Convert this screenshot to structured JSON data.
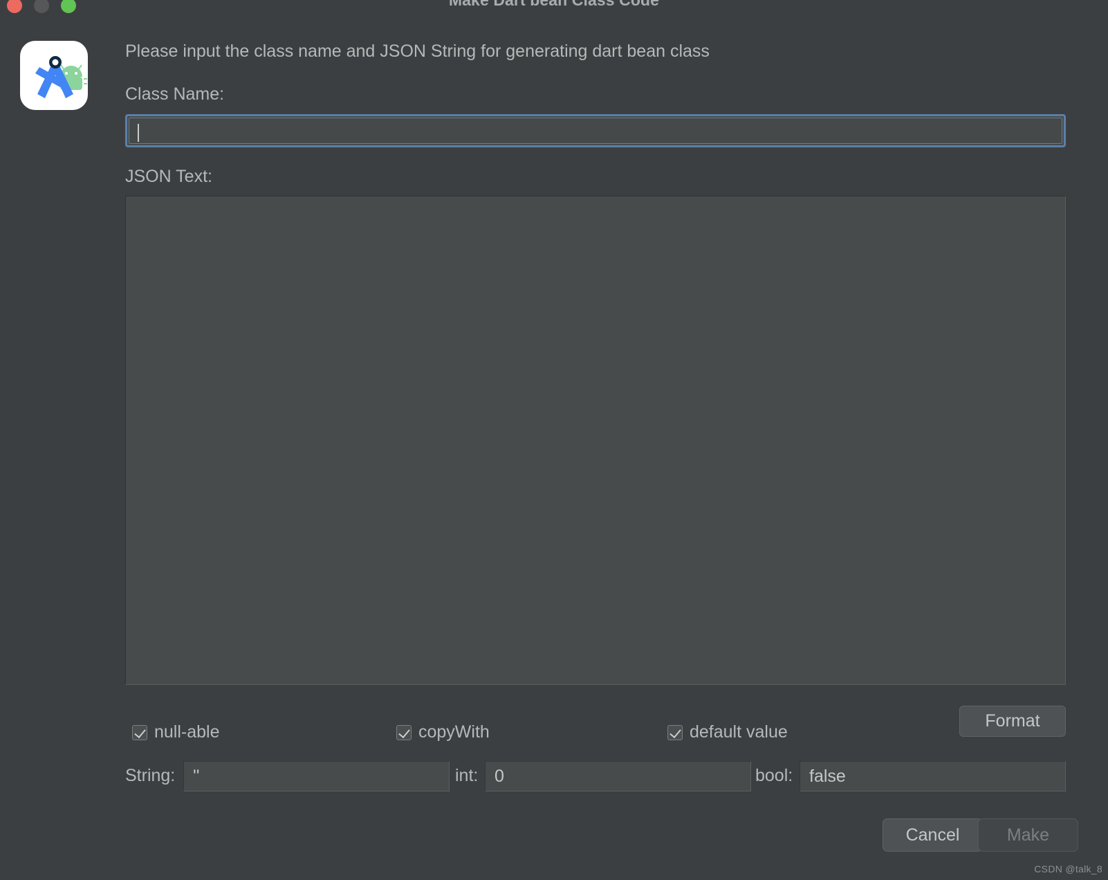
{
  "window": {
    "title": "Make Dart bean Class Code",
    "controls": {
      "close": "close-button",
      "minimize": "minimize-button",
      "zoom": "zoom-button"
    },
    "app_icon": "android-studio-icon"
  },
  "body": {
    "description": "Please input the class name and JSON String for generating dart bean class",
    "class_name": {
      "label": "Class Name:",
      "value": "",
      "placeholder": ""
    },
    "json_text": {
      "label": "JSON Text:",
      "value": "",
      "placeholder": ""
    }
  },
  "options": {
    "checkboxes": [
      {
        "name": "null-able",
        "label": "null-able",
        "checked": true
      },
      {
        "name": "copyWith",
        "label": "copyWith",
        "checked": true
      },
      {
        "name": "default value",
        "label": "default value",
        "checked": true
      }
    ],
    "format_label": "Format"
  },
  "defaults": {
    "string": {
      "label": "String:",
      "value": "''"
    },
    "int": {
      "label": "int:",
      "value": "0"
    },
    "bool": {
      "label": "bool:",
      "value": "false"
    }
  },
  "footer": {
    "cancel_label": "Cancel",
    "make_label": "Make",
    "make_enabled": false
  },
  "watermark": "CSDN @talk_8",
  "colors": {
    "dialog_bg": "#3c3f41",
    "field_bg": "#474b4c",
    "text": "#b6b8b9",
    "focus_border": "#5c7fa8",
    "close": "#ec6a5f",
    "minimize": "#555759",
    "zoom": "#61c554"
  }
}
